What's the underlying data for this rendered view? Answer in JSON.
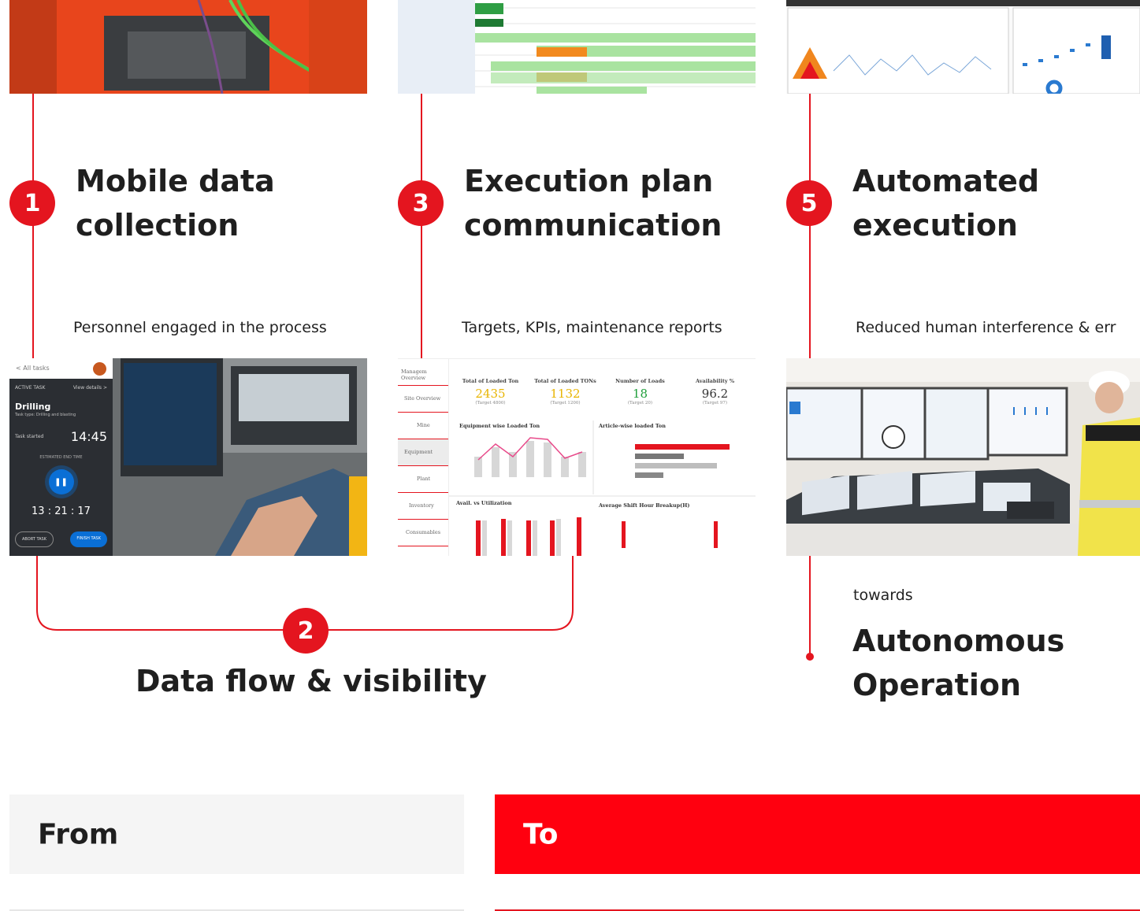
{
  "steps": [
    {
      "number": "1",
      "title_line1": "Mobile data",
      "title_line2": "collection",
      "subtitle": "Personnel engaged in the process"
    },
    {
      "number": "3",
      "title_line1": "Execution plan",
      "title_line2": "communication",
      "subtitle": "Targets, KPIs, maintenance reports"
    },
    {
      "number": "5",
      "title_line1": "Automated",
      "title_line2": "execution",
      "subtitle": "Reduced human interference & err"
    }
  ],
  "flow": {
    "number": "2",
    "label": "Data flow & visibility"
  },
  "autonomous": {
    "towards": "towards",
    "line1": "Autonomous",
    "line2": "Operation"
  },
  "mobile_app": {
    "back": "< All tasks",
    "active_task": "ACTIVE TASK",
    "view_details": "View details >",
    "task_name": "Drilling",
    "task_type": "Task type: Drilling and blasting",
    "started_label": "Task started",
    "started_time": "14:45",
    "estimated_label": "ESTIMATED END TIME",
    "countdown": "13 : 21 : 17",
    "abort": "ABORT TASK",
    "finish": "FINISH TASK"
  },
  "dashboard": {
    "nav": [
      "Managem Overview",
      "Site Overview",
      "Mine",
      "Equipment",
      "Plant",
      "Inventory",
      "Consumables"
    ],
    "kpis": [
      {
        "label": "Total of Loaded Ton",
        "value": "2435",
        "target": "(Target 4800)",
        "color": "#e8b400"
      },
      {
        "label": "Total of Loaded TONs",
        "value": "1132",
        "target": "(Target 1200)",
        "color": "#e8b400"
      },
      {
        "label": "Number of Loads",
        "value": "18",
        "target": "(Target 20)",
        "color": "#1e9e3a"
      },
      {
        "label": "Availability %",
        "value": "96.2",
        "target": "(Target 97)",
        "color": "#333333"
      }
    ],
    "panel1": "Equipment wise Loaded Ton",
    "panel2": "Article-wise loaded Ton",
    "panel3": "Avail. vs Utilization",
    "panel4": "Average Shift Hour Breakup(H)"
  },
  "from_to": {
    "from": "From",
    "to": "To"
  },
  "colors": {
    "accent": "#e4151f",
    "to_bg": "#ff000f",
    "from_bg": "#f5f5f5"
  }
}
